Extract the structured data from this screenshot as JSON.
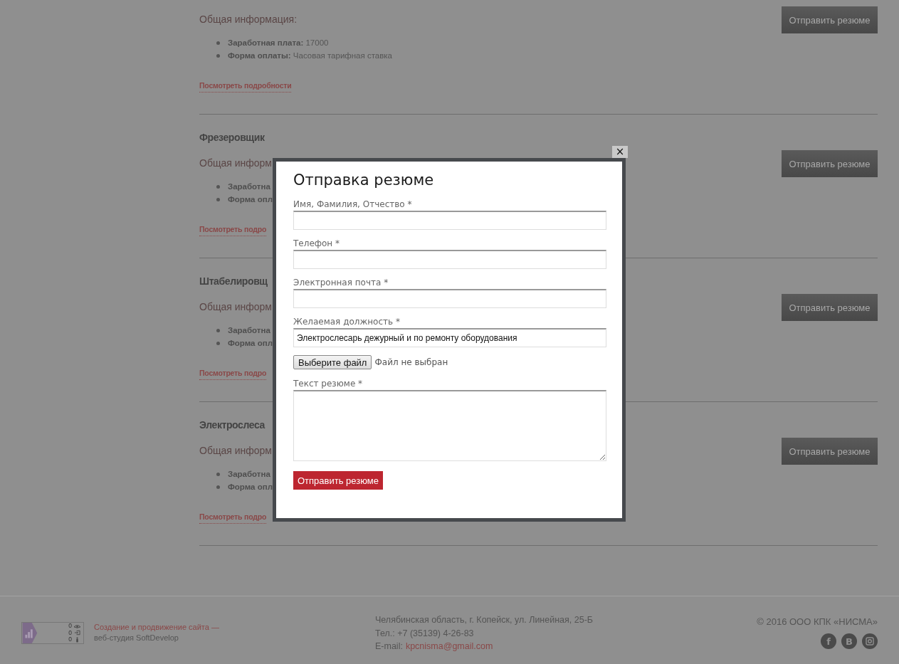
{
  "jobs": [
    {
      "info": "Общая информация:",
      "items": [
        {
          "label": "Заработная плата:",
          "value": "17000"
        },
        {
          "label": "Форма оплаты:",
          "value": "Часовая тарифная ставка"
        }
      ],
      "link": "Посмотреть подробности",
      "button": "Отправить резюме"
    },
    {
      "title": "Фрезеровщик",
      "info": "Общая информ",
      "items": [
        {
          "label": "Заработна"
        },
        {
          "label": "Форма опл"
        }
      ],
      "link": "Посмотреть подро",
      "button": "Отправить резюме"
    },
    {
      "title": "Штабелировщ",
      "info": "Общая информ",
      "items": [
        {
          "label": "Заработна"
        },
        {
          "label": "Форма опл"
        }
      ],
      "link": "Посмотреть подро",
      "button": "Отправить резюме"
    },
    {
      "title": "Электрослеса",
      "info": "Общая информ",
      "items": [
        {
          "label": "Заработна"
        },
        {
          "label": "Форма опл"
        }
      ],
      "link": "Посмотреть подро",
      "button": "Отправить резюме"
    }
  ],
  "modal": {
    "close": "×",
    "title": "Отправка резюме",
    "fields": [
      {
        "kind": "input",
        "label": "Имя, Фамилия, Отчество *"
      },
      {
        "kind": "input",
        "label": "Телефон *"
      },
      {
        "kind": "input",
        "label": "Электронная почта *"
      },
      {
        "kind": "input",
        "label": "Желаемая должность *",
        "value": "Электрослесарь дежурный и по ремонту оборудования"
      },
      {
        "kind": "file",
        "button": "Выберите файл",
        "status": "Файл не выбран"
      },
      {
        "kind": "textarea",
        "label": "Текст резюме *"
      }
    ],
    "submit": "Отправить резюме"
  },
  "footer": {
    "counter": [
      "0",
      "0",
      "0"
    ],
    "dev_link": "Создание и продвижение сайта —",
    "dev_text": "веб-студия SoftDevelop",
    "address": "Челябинская область, г. Копейск, ул. Линейная, 25-Б",
    "phone": "Тел.: +7 (35139) 4-26-83",
    "email_label": "E-mail:",
    "email": "kpcnisma@gmail.com",
    "copyright": "© 2016 ООО КПК «НИСМА»",
    "socials": [
      {
        "kind": "facebook",
        "glyph": "f"
      },
      {
        "kind": "vk",
        "glyph": "B"
      },
      {
        "kind": "instagram"
      }
    ]
  }
}
